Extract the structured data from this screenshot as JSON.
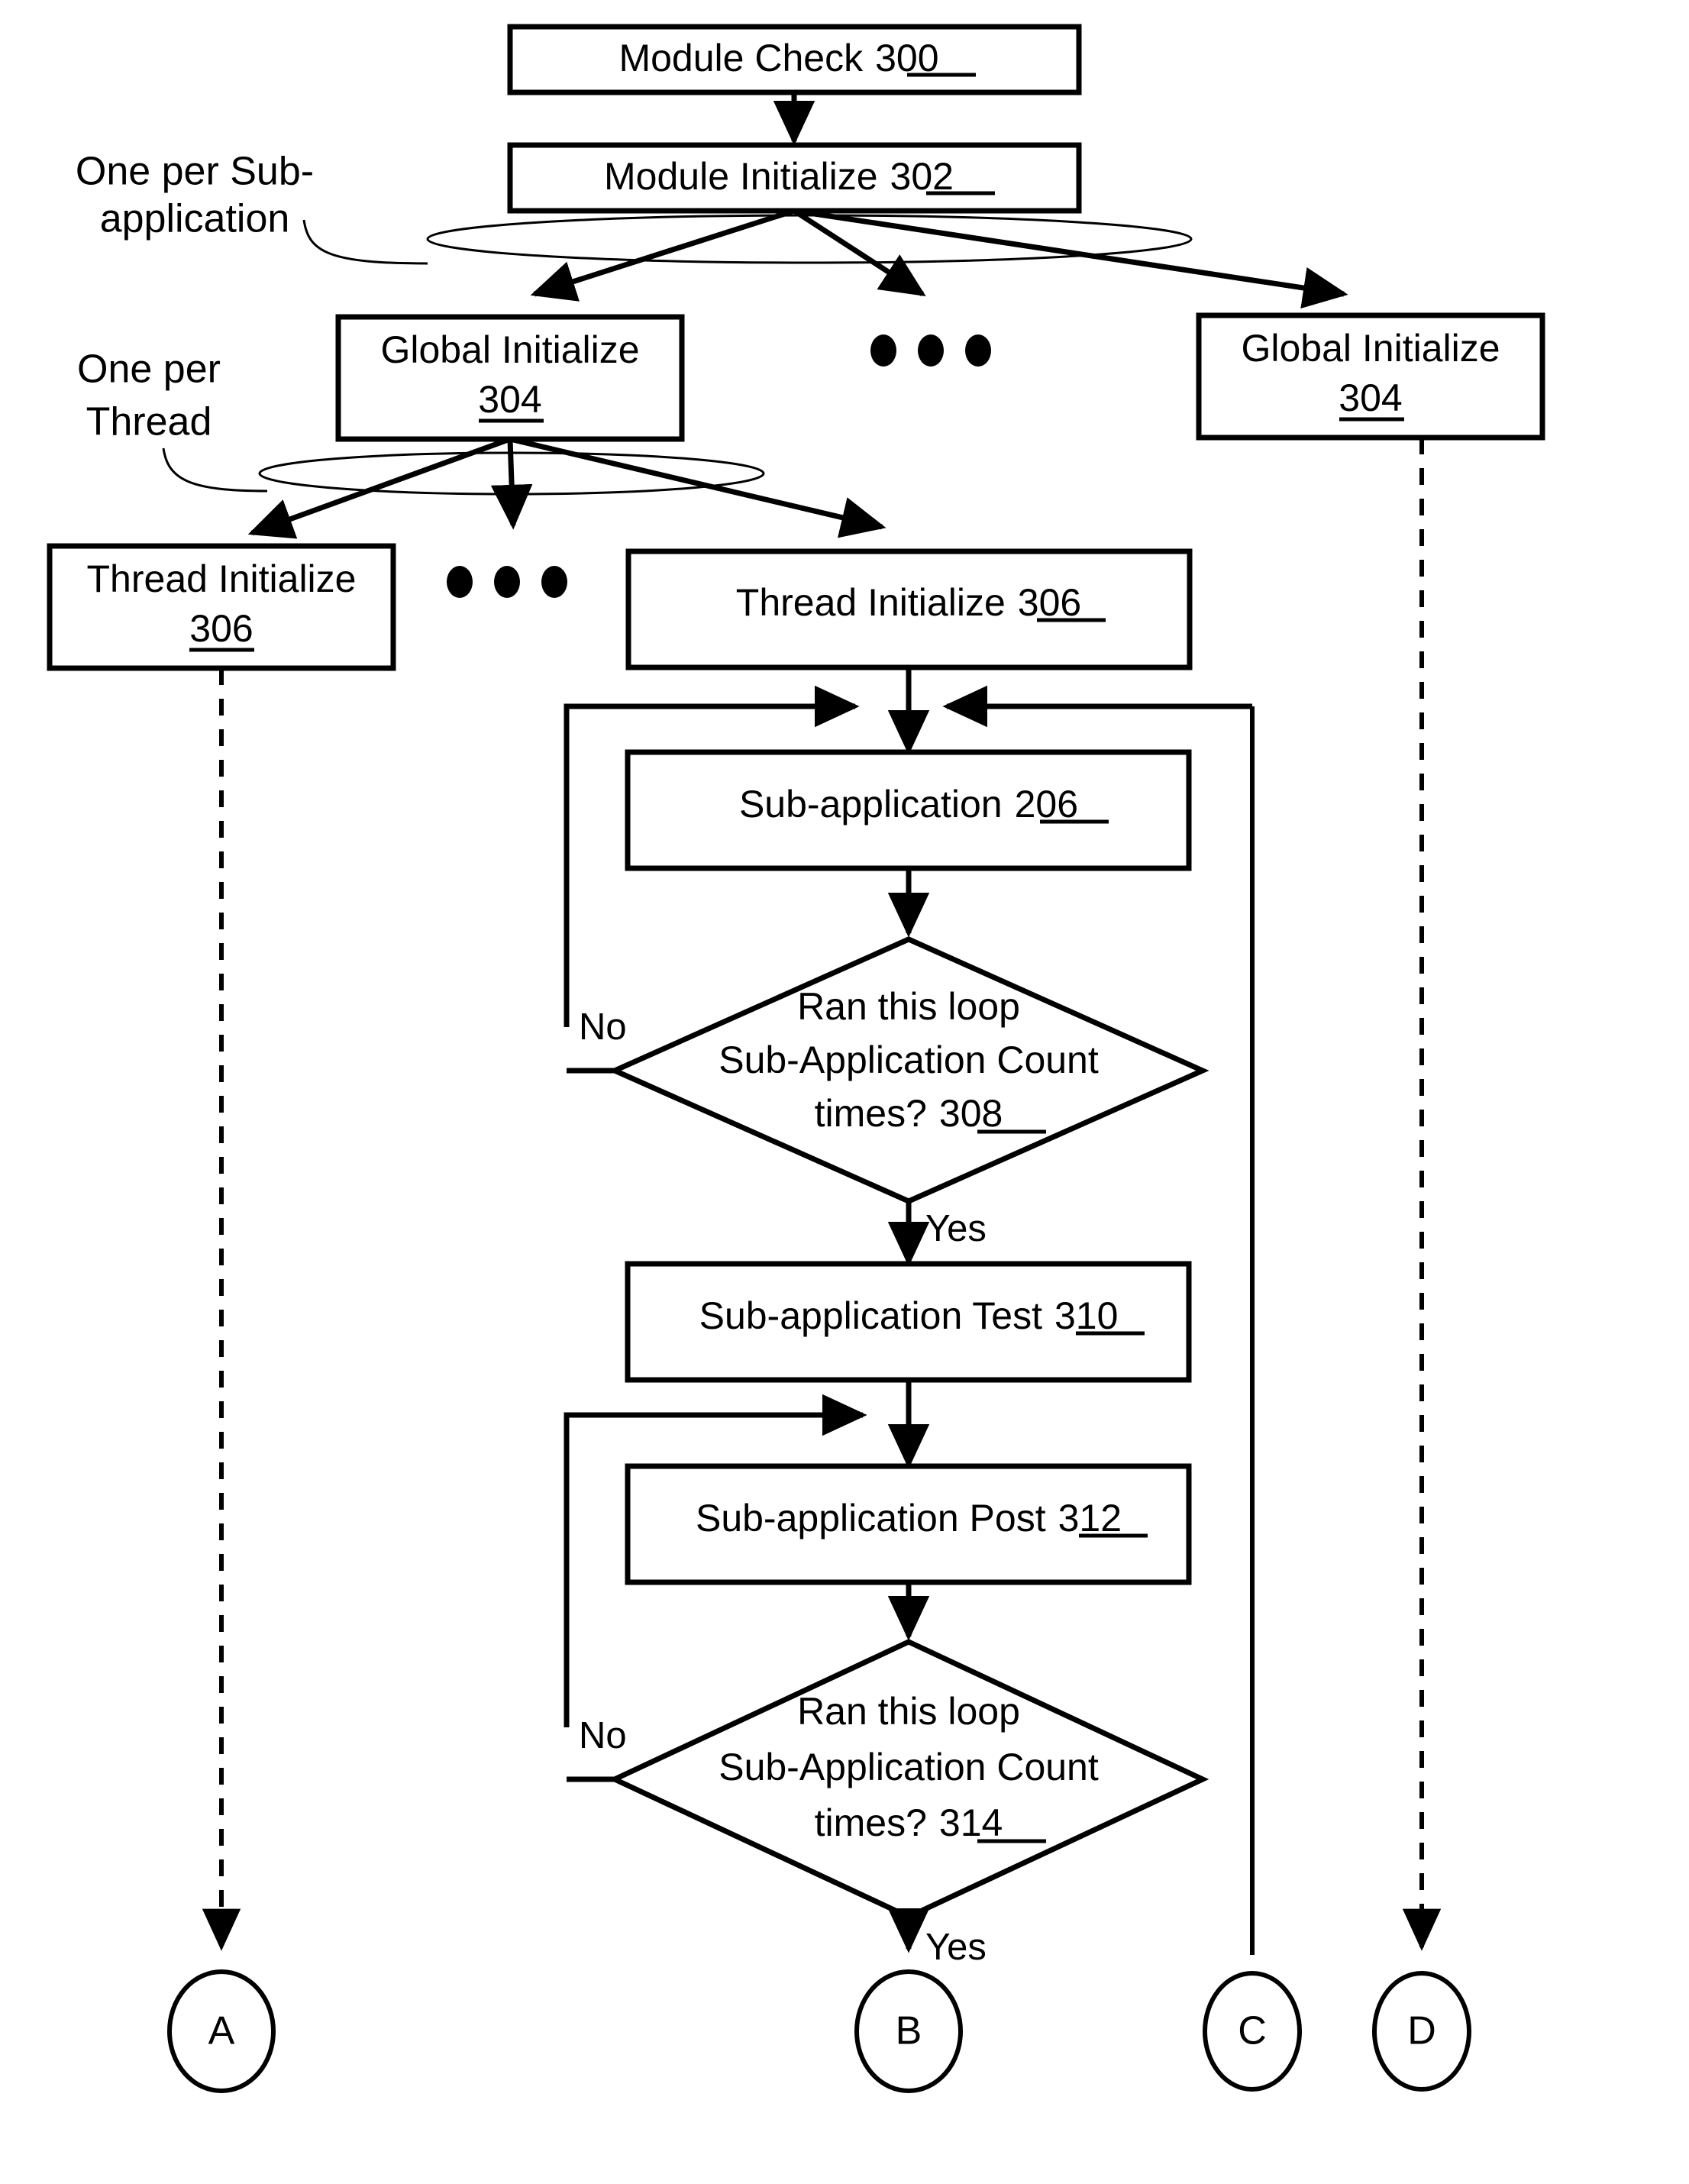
{
  "figure": {
    "type": "flowchart",
    "title": "",
    "nodes": [
      {
        "id": "n300",
        "shape": "process",
        "label": "Module Check",
        "ref": "300"
      },
      {
        "id": "n302",
        "shape": "process",
        "label": "Module Initialize",
        "ref": "302"
      },
      {
        "id": "n304a",
        "shape": "process",
        "label": "Global Initialize",
        "ref": "304"
      },
      {
        "id": "n304b",
        "shape": "process",
        "label": "Global Initialize",
        "ref": "304"
      },
      {
        "id": "n306a",
        "shape": "process",
        "label": "Thread Initialize",
        "ref": "306"
      },
      {
        "id": "n306b",
        "shape": "process",
        "label": "Thread Initialize",
        "ref": "306"
      },
      {
        "id": "n206",
        "shape": "process",
        "label": "Sub-application",
        "ref": "206"
      },
      {
        "id": "n308",
        "shape": "decision",
        "line1": "Ran this loop",
        "line2": "Sub-Application Count",
        "line3": "times?",
        "ref": "308"
      },
      {
        "id": "n310",
        "shape": "process",
        "label": "Sub-application Test",
        "ref": "310"
      },
      {
        "id": "n312",
        "shape": "process",
        "label": "Sub-application Post",
        "ref": "312"
      },
      {
        "id": "n314",
        "shape": "decision",
        "line1": "Ran this loop",
        "line2": "Sub-Application Count",
        "line3": "times?",
        "ref": "314"
      }
    ],
    "side_labels": [
      {
        "id": "lbl_subapp",
        "line1": "One per Sub-",
        "line2": "application"
      },
      {
        "id": "lbl_thread",
        "line1": "One per",
        "line2": "Thread"
      }
    ],
    "edge_labels": {
      "no_308": "No",
      "yes_308": "Yes",
      "no_314": "No",
      "yes_314": "Yes"
    },
    "connectors": [
      {
        "id": "conn_a",
        "label": "A"
      },
      {
        "id": "conn_b",
        "label": "B"
      },
      {
        "id": "conn_c",
        "label": "C"
      },
      {
        "id": "conn_d",
        "label": "D"
      }
    ],
    "ellipsis": "• • •",
    "colors": {
      "stroke": "#000000",
      "fill": "#ffffff",
      "background": "#ffffff"
    }
  }
}
